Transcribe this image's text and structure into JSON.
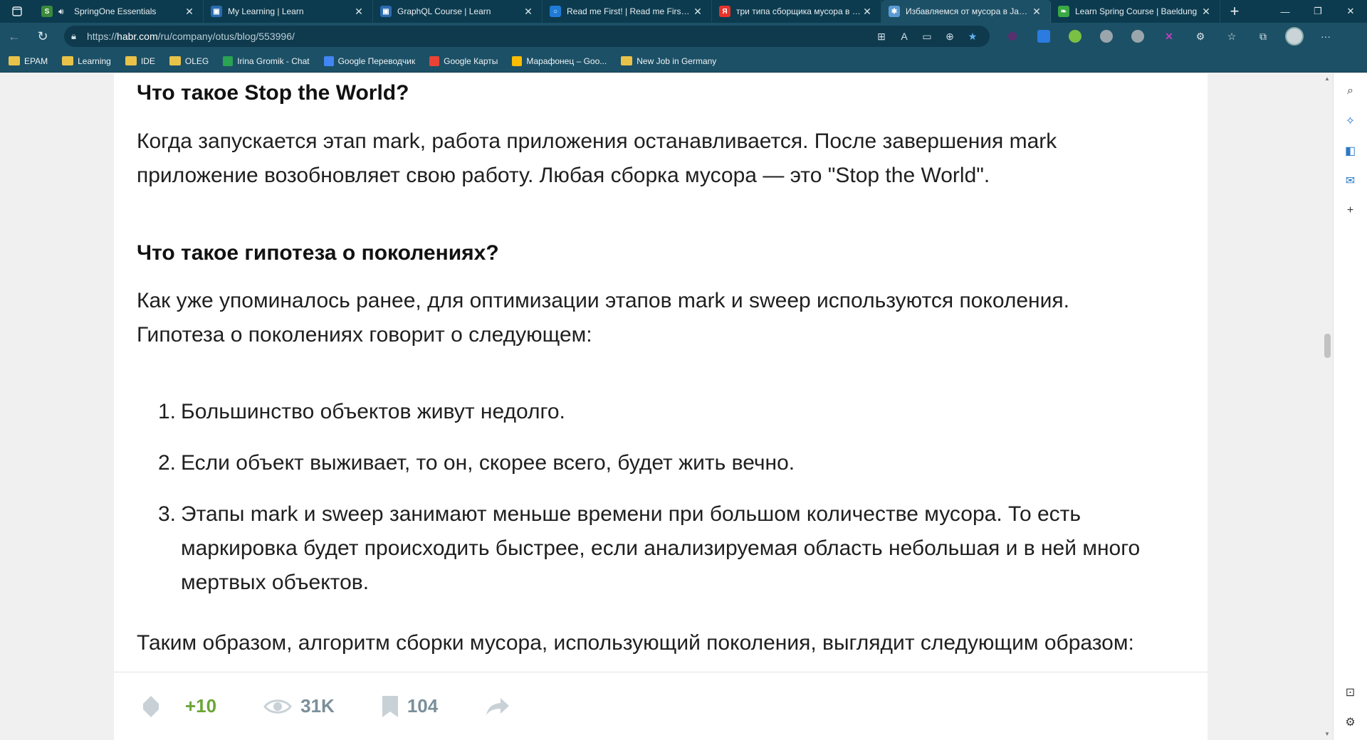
{
  "browser": {
    "tabs": [
      {
        "title": "SpringOne Essentials",
        "favicon_color": "#3b8a3b",
        "favicon_glyph": "S",
        "audio": true,
        "active": false
      },
      {
        "title": "My Learning | Learn",
        "favicon_color": "#2b6cb0",
        "favicon_glyph": "▣",
        "audio": false,
        "active": false
      },
      {
        "title": "GraphQL Course | Learn",
        "favicon_color": "#2b6cb0",
        "favicon_glyph": "▣",
        "audio": false,
        "active": false
      },
      {
        "title": "Read me First! | Read me First! | A",
        "favicon_color": "#1f7bd6",
        "favicon_glyph": "○",
        "audio": false,
        "active": false
      },
      {
        "title": "три типа сборщика мусора в ла",
        "favicon_color": "#e8322a",
        "favicon_glyph": "Я",
        "audio": false,
        "active": false
      },
      {
        "title": "Избавляемся от мусора в Java /",
        "favicon_color": "#5b9bd5",
        "favicon_glyph": "✱",
        "audio": false,
        "active": true
      },
      {
        "title": "Learn Spring Course | Baeldung",
        "favicon_color": "#3aa845",
        "favicon_glyph": "❧",
        "audio": false,
        "active": false
      }
    ],
    "url_prefix": "https://",
    "url_host": "habr.com",
    "url_path": "/ru/company/otus/blog/553996/",
    "bookmarks": [
      {
        "label": "EPAM",
        "type": "folder"
      },
      {
        "label": "Learning",
        "type": "folder"
      },
      {
        "label": "IDE",
        "type": "folder"
      },
      {
        "label": "OLEG",
        "type": "folder"
      },
      {
        "label": "Irina Gromik - Chat",
        "type": "chat",
        "color": "#2aa352"
      },
      {
        "label": "Google Переводчик",
        "type": "translate",
        "color": "#4285f4"
      },
      {
        "label": "Google Карты",
        "type": "maps",
        "color": "#ea4335"
      },
      {
        "label": "Марафонец – Goo...",
        "type": "drive",
        "color": "#fbbc04"
      },
      {
        "label": "New Job in Germany",
        "type": "folder"
      }
    ]
  },
  "article": {
    "heading1": "Что такое Stop the World?",
    "para1": "Когда запускается этап mark, работа приложения останавливается. После завершения mark приложение возобновляет свою работу. Любая сборка мусора — это \"Stop the World\".",
    "heading2": "Что такое гипотеза о поколениях?",
    "para2": "Как уже упоминалось ранее, для оптимизации этапов mark и sweep используются поколения. Гипотеза о поколениях говорит о следующем:",
    "list": [
      {
        "num": "1.",
        "text": "Большинство объектов живут недолго."
      },
      {
        "num": "2.",
        "text": "Если объект выживает, то он, скорее всего, будет жить вечно."
      },
      {
        "num": "3.",
        "text": "Этапы mark и sweep занимают меньше времени при большом количестве мусора. То есть маркировка будет происходить быстрее, если анализируемая область небольшая и в ней много мертвых объектов."
      }
    ],
    "para3": "Таким образом, алгоритм сборки мусора, использующий поколения, выглядит следующим образом:"
  },
  "actions": {
    "rating": "+10",
    "views": "31K",
    "bookmarks": "104"
  },
  "colors": {
    "rating": "#6aa535",
    "muted_icon": "#c8d1d6",
    "counter": "#7a8f9a"
  }
}
